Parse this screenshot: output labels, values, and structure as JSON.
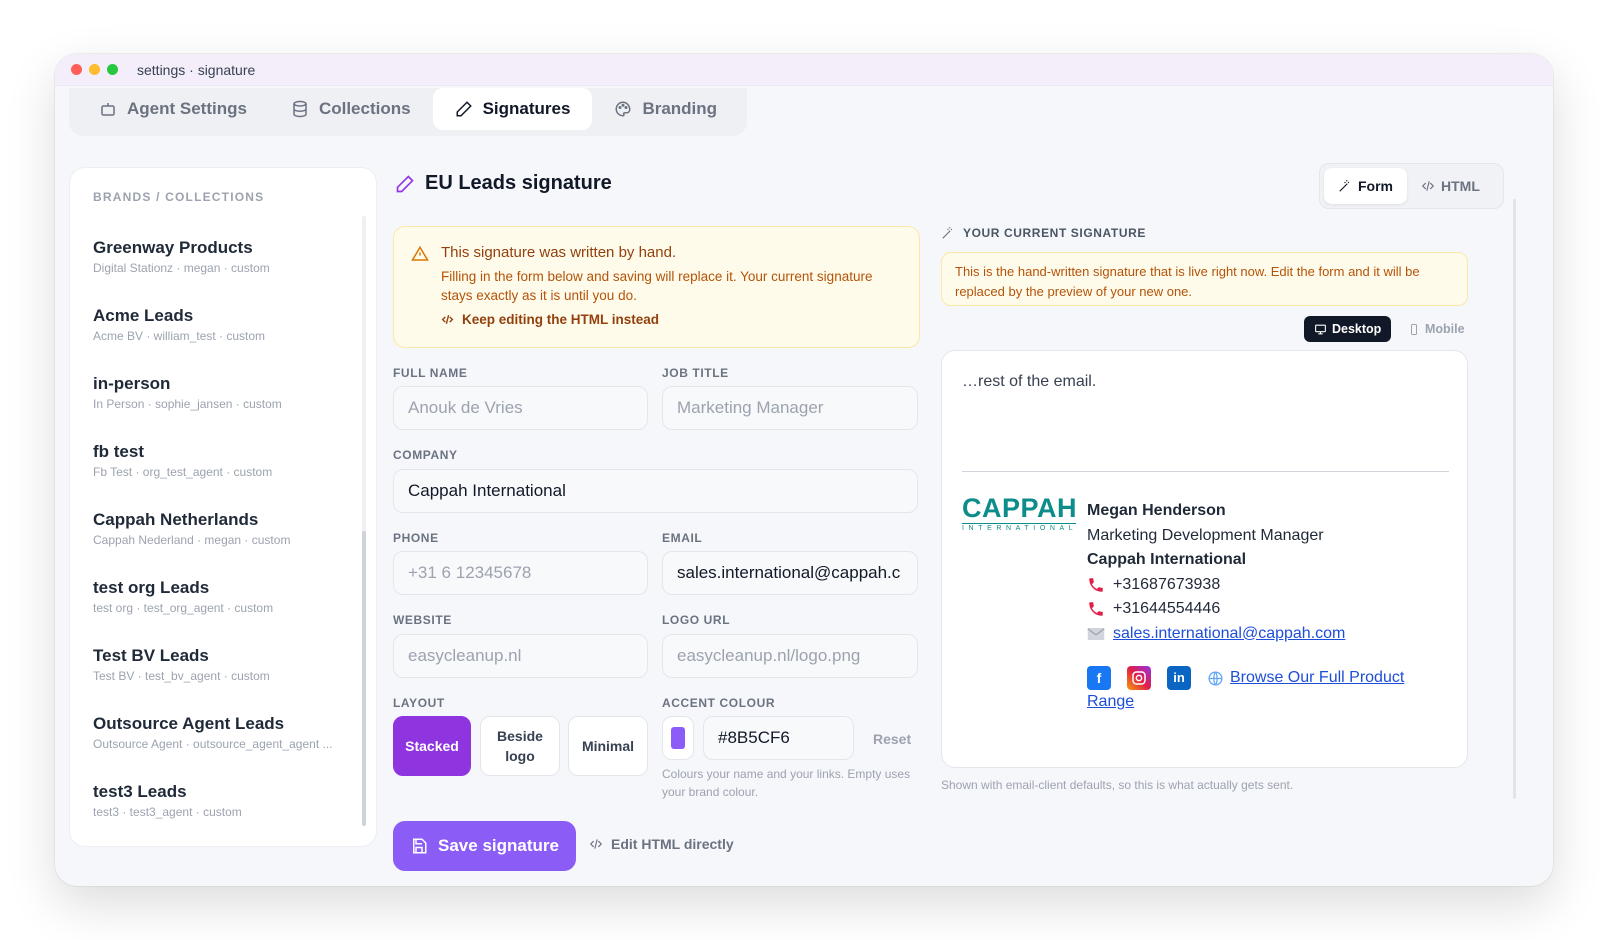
{
  "window": {
    "title": "settings · signature"
  },
  "tabs": [
    {
      "label": "Agent Settings",
      "icon": "bot-icon"
    },
    {
      "label": "Collections",
      "icon": "database-icon"
    },
    {
      "label": "Signatures",
      "icon": "pen-icon",
      "active": true
    },
    {
      "label": "Branding",
      "icon": "palette-icon"
    }
  ],
  "sidebar": {
    "heading": "BRANDS / COLLECTIONS",
    "items": [
      {
        "name": "Greenway Products",
        "meta": "Digital Stationz · megan · custom"
      },
      {
        "name": "Acme Leads",
        "meta": "Acme BV · william_test · custom"
      },
      {
        "name": "in-person",
        "meta": "In Person · sophie_jansen · custom"
      },
      {
        "name": "fb test",
        "meta": "Fb Test · org_test_agent · custom"
      },
      {
        "name": "Cappah Netherlands",
        "meta": "Cappah Nederland · megan · custom"
      },
      {
        "name": "test org Leads",
        "meta": "test org · test_org_agent · custom"
      },
      {
        "name": "Test BV Leads",
        "meta": "Test BV · test_bv_agent · custom"
      },
      {
        "name": "Outsource Agent Leads",
        "meta": "Outsource Agent · outsource_agent_agent ..."
      },
      {
        "name": "test3 Leads",
        "meta": "test3 · test3_agent · custom"
      }
    ]
  },
  "main": {
    "title": "EU Leads signature",
    "mode": {
      "form": "Form",
      "html": "HTML"
    },
    "alert": {
      "heading": "This signature was written by hand.",
      "body": "Filling in the form below and saving will replace it. Your current signature stays exactly as it is until you do.",
      "link": "Keep editing the HTML instead"
    },
    "form": {
      "full_name": {
        "label": "FULL NAME",
        "placeholder": "Anouk de Vries"
      },
      "job_title": {
        "label": "JOB TITLE",
        "placeholder": "Marketing Manager"
      },
      "company": {
        "label": "COMPANY",
        "value": "Cappah International"
      },
      "phone": {
        "label": "PHONE",
        "placeholder": "+31 6 12345678"
      },
      "email": {
        "label": "EMAIL",
        "value": "sales.international@cappah.c"
      },
      "website": {
        "label": "WEBSITE",
        "placeholder": "easycleanup.nl"
      },
      "logo_url": {
        "label": "LOGO URL",
        "placeholder": "easycleanup.nl/logo.png"
      },
      "layout": {
        "label": "LAYOUT",
        "options": [
          "Stacked",
          "Beside logo",
          "Minimal"
        ],
        "selected": "Stacked"
      },
      "accent": {
        "label": "ACCENT COLOUR",
        "value": "#8B5CF6",
        "reset": "Reset",
        "hint": "Colours your name and your links. Empty uses your brand colour."
      }
    },
    "save_label": "Save signature",
    "edit_html_label": "Edit HTML directly"
  },
  "preview": {
    "label": "YOUR CURRENT SIGNATURE",
    "notice": "This is the hand-written signature that is live right now. Edit the form and it will be replaced by the preview of your new one.",
    "device": {
      "desktop": "Desktop",
      "mobile": "Mobile"
    },
    "rest": "…rest of the email.",
    "logo": {
      "big": "CAPPAH",
      "small": "INTERNATIONAL"
    },
    "name": "Megan Henderson",
    "title": "Marketing Development Manager",
    "company": "Cappah International",
    "phone1": "+31687673938",
    "phone2": "+31644554446",
    "email": "sales.international@cappah.com",
    "browse": "Browse Our Full Product Range",
    "footer": "Shown with email-client defaults, so this is what actually gets sent."
  },
  "colors": {
    "accent": "#8B5CF6",
    "active_layout": "#8F35E0",
    "warning_bg": "#FFFBEB",
    "warning_text": "#B45309",
    "brand_teal": "#0D8D8A"
  }
}
